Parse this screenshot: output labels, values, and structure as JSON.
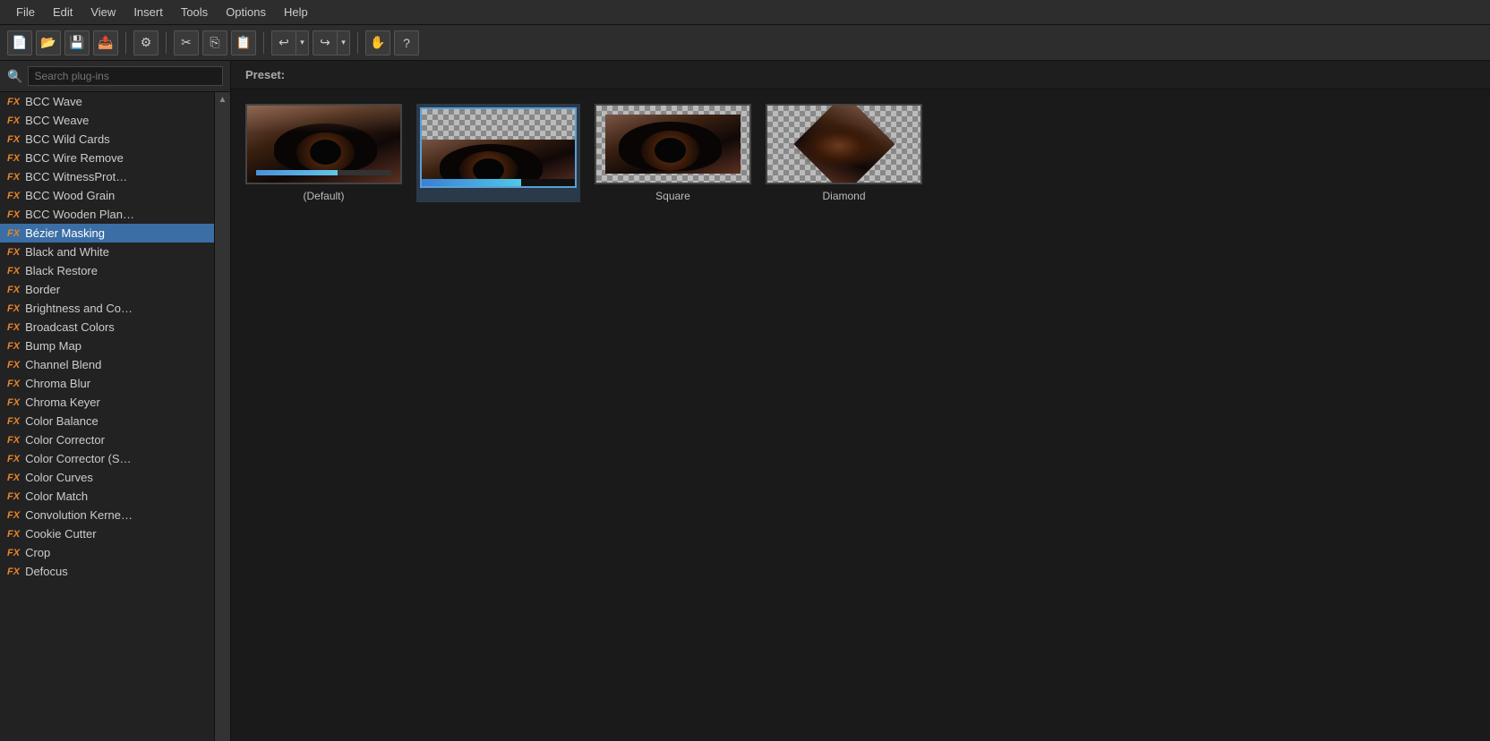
{
  "menubar": {
    "items": [
      "File",
      "Edit",
      "View",
      "Insert",
      "Tools",
      "Options",
      "Help"
    ]
  },
  "toolbar": {
    "buttons": [
      {
        "name": "new",
        "icon": "📄"
      },
      {
        "name": "open",
        "icon": "📂"
      },
      {
        "name": "save",
        "icon": "💾"
      },
      {
        "name": "export",
        "icon": "📤"
      },
      {
        "name": "settings",
        "icon": "⚙"
      },
      {
        "name": "cut",
        "icon": "✂"
      },
      {
        "name": "copy",
        "icon": "⎘"
      },
      {
        "name": "paste",
        "icon": "📋"
      },
      {
        "name": "undo",
        "icon": "↩"
      },
      {
        "name": "redo",
        "icon": "↪"
      },
      {
        "name": "hand",
        "icon": "✋"
      },
      {
        "name": "help",
        "icon": "?"
      }
    ]
  },
  "search": {
    "placeholder": "Search plug-ins"
  },
  "preset_label": "Preset:",
  "plugins": [
    {
      "id": "bcc-wave",
      "name": "BCC Wave",
      "selected": false
    },
    {
      "id": "bcc-weave",
      "name": "BCC Weave",
      "selected": false
    },
    {
      "id": "bcc-wild-cards",
      "name": "BCC Wild Cards",
      "selected": false
    },
    {
      "id": "bcc-wire-remove",
      "name": "BCC Wire Remove",
      "selected": false
    },
    {
      "id": "bcc-witness-prot",
      "name": "BCC WitnessProt…",
      "selected": false
    },
    {
      "id": "bcc-wood-grain",
      "name": "BCC Wood Grain",
      "selected": false
    },
    {
      "id": "bcc-wooden-plan",
      "name": "BCC Wooden Plan…",
      "selected": false
    },
    {
      "id": "bezier-masking",
      "name": "Bézier Masking",
      "selected": true
    },
    {
      "id": "black-and-white",
      "name": "Black and White",
      "selected": false
    },
    {
      "id": "black-restore",
      "name": "Black Restore",
      "selected": false
    },
    {
      "id": "border",
      "name": "Border",
      "selected": false
    },
    {
      "id": "brightness-and-co",
      "name": "Brightness and Co…",
      "selected": false
    },
    {
      "id": "broadcast-colors",
      "name": "Broadcast Colors",
      "selected": false
    },
    {
      "id": "bump-map",
      "name": "Bump Map",
      "selected": false
    },
    {
      "id": "channel-blend",
      "name": "Channel Blend",
      "selected": false
    },
    {
      "id": "chroma-blur",
      "name": "Chroma Blur",
      "selected": false
    },
    {
      "id": "chroma-keyer",
      "name": "Chroma Keyer",
      "selected": false
    },
    {
      "id": "color-balance",
      "name": "Color Balance",
      "selected": false
    },
    {
      "id": "color-corrector",
      "name": "Color Corrector",
      "selected": false
    },
    {
      "id": "color-corrector-s",
      "name": "Color Corrector (S…",
      "selected": false
    },
    {
      "id": "color-curves",
      "name": "Color Curves",
      "selected": false
    },
    {
      "id": "color-match",
      "name": "Color Match",
      "selected": false
    },
    {
      "id": "convolution-kerne",
      "name": "Convolution Kerne…",
      "selected": false
    },
    {
      "id": "cookie-cutter",
      "name": "Cookie Cutter",
      "selected": false
    },
    {
      "id": "crop",
      "name": "Crop",
      "selected": false
    },
    {
      "id": "defocus",
      "name": "Defocus",
      "selected": false
    }
  ],
  "presets": [
    {
      "id": "default",
      "label": "(Default)",
      "active": false
    },
    {
      "id": "default2",
      "label": "",
      "active": true
    },
    {
      "id": "square",
      "label": "Square",
      "active": false
    },
    {
      "id": "diamond",
      "label": "Diamond",
      "active": false
    }
  ]
}
